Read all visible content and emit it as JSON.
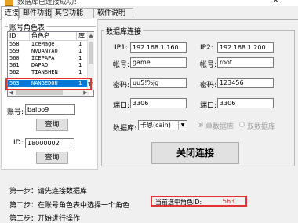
{
  "window": {
    "title": "数据库已连接成功！"
  },
  "tabs": [
    "连接",
    "邮件功能",
    "其它功能",
    "软件说明"
  ],
  "account_panel": {
    "group_title": "账号角色表",
    "columns": [
      "ID",
      "角色名",
      "库"
    ],
    "rows": [
      {
        "id": "558",
        "name": "IceMage",
        "db": "1"
      },
      {
        "id": "559",
        "name": "NVDANYAO",
        "db": "1"
      },
      {
        "id": "560",
        "name": "ICEPAPA",
        "db": "1"
      },
      {
        "id": "561",
        "name": "DAPAO",
        "db": "1"
      },
      {
        "id": "562",
        "name": "TIANSHEN",
        "db": "1"
      },
      {
        "id": "563",
        "name": "NANGEDOU",
        "db": "1"
      }
    ],
    "selected_row": 5,
    "account_label": "账号:",
    "account_value": "baibo9",
    "query_label": "查询",
    "id_label": "ID:",
    "id_value": "18000002",
    "query2_label": "查询"
  },
  "db_panel": {
    "group_title": "数据库连接",
    "ip1_label": "IP1:",
    "ip1_value": "192.168.1.160",
    "ip2_label": "IP2:",
    "ip2_value": "192.168.1.200",
    "account1_label": "帐号:",
    "account1_value": "game",
    "account2_label": "帐号:",
    "account2_value": "root",
    "password1_label": "密码:",
    "password1_value": "uu5!%jg",
    "password2_label": "密码:",
    "password2_value": "123456",
    "port1_label": "端口:",
    "port1_value": "3306",
    "port2_label": "端口:",
    "port2_value": "3306",
    "database_label": "数据库:",
    "database_value": "卡恩(cain)",
    "single_db_label": "单数据库",
    "dual_db_label": "双数据库",
    "close_button": "关闭连接"
  },
  "steps": {
    "step1": "第一步：请先连接数据库",
    "step2": "第二步：在账号角色表中选择一个角色",
    "step3": "第三步：开始进行操作"
  },
  "selection": {
    "label": "当前选中角色ID:",
    "value": "563"
  }
}
